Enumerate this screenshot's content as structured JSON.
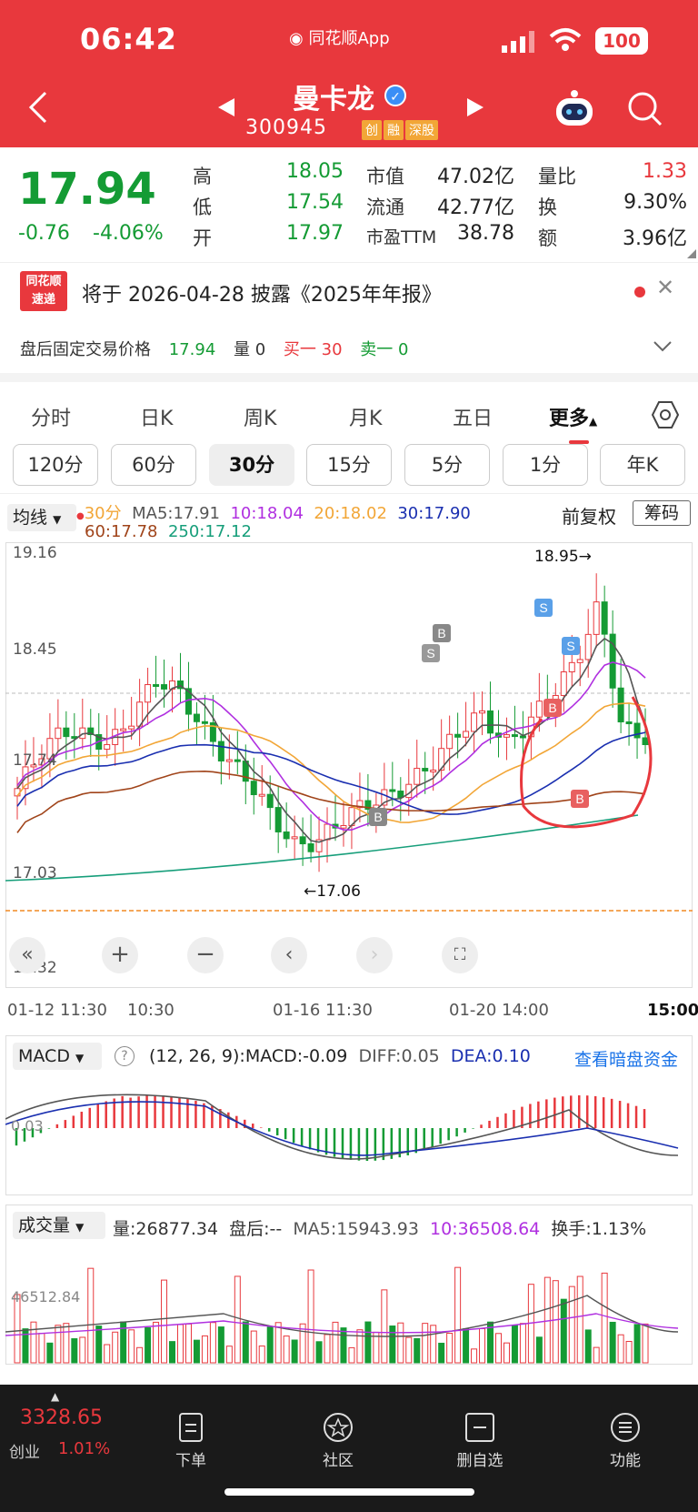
{
  "status": {
    "time": "06:42",
    "app": "同花顺App",
    "battery": "100"
  },
  "stock": {
    "name": "曼卡龙",
    "code": "300945",
    "tags": [
      "创",
      "融",
      "深股"
    ]
  },
  "quote": {
    "price": "17.94",
    "change": "-0.76",
    "pct": "-4.06%",
    "rows": [
      {
        "l1": "高",
        "v1": "18.05",
        "l2": "市值",
        "v2": "47.02亿",
        "l3": "量比",
        "v3": "1.33"
      },
      {
        "l1": "低",
        "v1": "17.54",
        "l2": "流通",
        "v2": "42.77亿",
        "l3": "换",
        "v3": "9.30%"
      },
      {
        "l1": "开",
        "v1": "17.97",
        "l2": "市盈TTM",
        "v2": "38.78",
        "l3": "额",
        "v3": "3.96亿"
      }
    ]
  },
  "notice": {
    "logo1": "同花顺",
    "logo2": "速递",
    "text": "将于 2026-04-28 披露《2025年年报》"
  },
  "afterhours": {
    "label": "盘后固定交易价格",
    "price": "17.94",
    "vol": "量 0",
    "buy": "买一 30",
    "sell": "卖一 0"
  },
  "tabs": [
    "分时",
    "日K",
    "周K",
    "月K",
    "五日",
    "更多"
  ],
  "periods": [
    "120分",
    "60分",
    "30分",
    "15分",
    "5分",
    "1分",
    "年K"
  ],
  "ma": {
    "type": "均线",
    "p": "30分",
    "ma5": "MA5:17.91",
    "ma10": "10:18.04",
    "ma20": "20:18.02",
    "ma30": "30:17.90",
    "ma60": "60:17.78",
    "ma250": "250:17.12",
    "fq": "前复权",
    "chip": "筹码"
  },
  "chart_data": {
    "type": "candlestick",
    "yticks": [
      "19.16",
      "18.45",
      "17.74",
      "17.03",
      "16.32"
    ],
    "xticks": [
      "01-12 11:30",
      "10:30",
      "01-16 11:30",
      "01-20 14:00",
      "15:00"
    ],
    "annotations": [
      "18.95→",
      "←17.06"
    ],
    "markers": [
      "S",
      "S",
      "S",
      "B",
      "B",
      "B",
      "B",
      "B"
    ]
  },
  "macd": {
    "name": "MACD",
    "params": "(12, 26, 9):",
    "macd": "MACD:-0.09",
    "diff": "DIFF:0.05",
    "dea": "DEA:0.10",
    "link": "查看暗盘资金",
    "tick": "0.03"
  },
  "volume": {
    "name": "成交量",
    "vol": "量:26877.34",
    "after": "盘后:--",
    "ma5": "MA5:15943.93",
    "ma10": "10:36508.64",
    "turn": "换手:1.13%",
    "tick": "46512.84"
  },
  "bottom": {
    "index": "3328.65",
    "idxname": "创业",
    "idxpct": "1.01%",
    "nav": [
      "下单",
      "社区",
      "删自选",
      "功能"
    ]
  }
}
